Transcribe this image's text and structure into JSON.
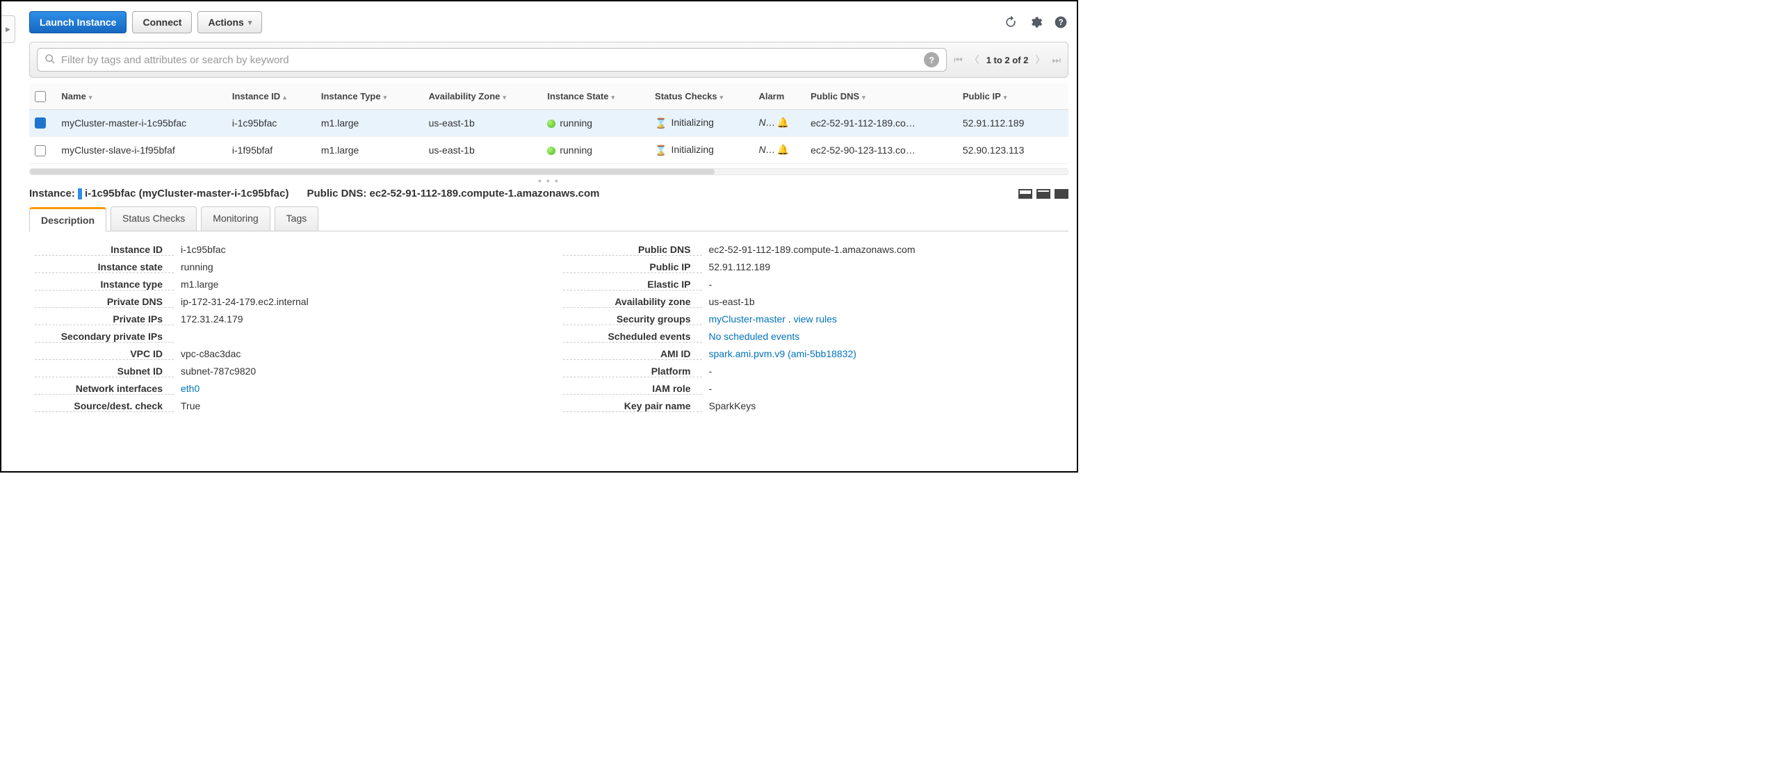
{
  "toolbar": {
    "launch": "Launch Instance",
    "connect": "Connect",
    "actions": "Actions"
  },
  "search": {
    "placeholder": "Filter by tags and attributes or search by keyword"
  },
  "pagination": {
    "text": "1 to 2 of 2"
  },
  "columns": {
    "name": "Name",
    "instance_id": "Instance ID",
    "instance_type": "Instance Type",
    "az": "Availability Zone",
    "state": "Instance State",
    "status": "Status Checks",
    "alarm": "Alarm",
    "pdns": "Public DNS",
    "pip": "Public IP"
  },
  "rows": [
    {
      "name": "myCluster-master-i-1c95bfac",
      "instance_id": "i-1c95bfac",
      "instance_type": "m1.large",
      "az": "us-east-1b",
      "state": "running",
      "status": "Initializing",
      "alarm": "N…",
      "pdns": "ec2-52-91-112-189.co…",
      "pip": "52.91.112.189",
      "selected": true
    },
    {
      "name": "myCluster-slave-i-1f95bfaf",
      "instance_id": "i-1f95bfaf",
      "instance_type": "m1.large",
      "az": "us-east-1b",
      "state": "running",
      "status": "Initializing",
      "alarm": "N…",
      "pdns": "ec2-52-90-123-113.co…",
      "pip": "52.90.123.113",
      "selected": false
    }
  ],
  "detail": {
    "instance_label": "Instance:",
    "instance_value": "i-1c95bfac (myCluster-master-i-1c95bfac)",
    "pdns_label": "Public DNS:",
    "pdns_value": "ec2-52-91-112-189.compute-1.amazonaws.com",
    "tabs": {
      "description": "Description",
      "status": "Status Checks",
      "monitoring": "Monitoring",
      "tags": "Tags"
    },
    "left": {
      "instance_id_k": "Instance ID",
      "instance_id_v": "i-1c95bfac",
      "instance_state_k": "Instance state",
      "instance_state_v": "running",
      "instance_type_k": "Instance type",
      "instance_type_v": "m1.large",
      "private_dns_k": "Private DNS",
      "private_dns_v": "ip-172-31-24-179.ec2.internal",
      "private_ips_k": "Private IPs",
      "private_ips_v": "172.31.24.179",
      "secondary_ips_k": "Secondary private IPs",
      "secondary_ips_v": "",
      "vpc_id_k": "VPC ID",
      "vpc_id_v": "vpc-c8ac3dac",
      "subnet_id_k": "Subnet ID",
      "subnet_id_v": "subnet-787c9820",
      "ni_k": "Network interfaces",
      "ni_v": "eth0",
      "srcdest_k": "Source/dest. check",
      "srcdest_v": "True"
    },
    "right": {
      "pdns_k": "Public DNS",
      "pdns_v": "ec2-52-91-112-189.compute-1.amazonaws.com",
      "pip_k": "Public IP",
      "pip_v": "52.91.112.189",
      "eip_k": "Elastic IP",
      "eip_v": "-",
      "az_k": "Availability zone",
      "az_v": "us-east-1b",
      "sg_k": "Security groups",
      "sg_v": "myCluster-master",
      "sg_link": "view rules",
      "sched_k": "Scheduled events",
      "sched_v": "No scheduled events",
      "ami_k": "AMI ID",
      "ami_v": "spark.ami.pvm.v9 (ami-5bb18832)",
      "platform_k": "Platform",
      "platform_v": "-",
      "iam_k": "IAM role",
      "iam_v": "-",
      "keypair_k": "Key pair name",
      "keypair_v": "SparkKeys"
    }
  }
}
